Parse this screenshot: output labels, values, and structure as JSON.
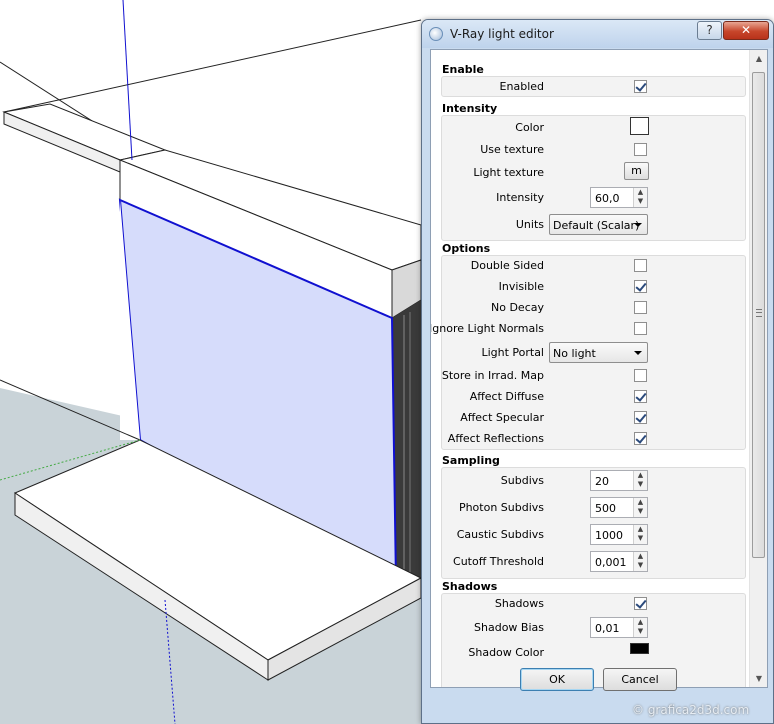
{
  "viewport": {
    "background_color": "#ffffff",
    "ground_color": "#c9d3d8",
    "light_fill": "#d6dcfb",
    "edge_blue": "#1010d0"
  },
  "dialog": {
    "title": "V-Ray light editor",
    "help_label": "?",
    "close_label": "✕",
    "ok_label": "OK",
    "cancel_label": "Cancel"
  },
  "sections": {
    "enable": {
      "title": "Enable",
      "enabled": {
        "label": "Enabled",
        "checked": true
      }
    },
    "intensity": {
      "title": "Intensity",
      "color": {
        "label": "Color",
        "value": "#ffffff"
      },
      "use_texture": {
        "label": "Use texture",
        "checked": false
      },
      "light_texture": {
        "label": "Light texture",
        "button": "m"
      },
      "intensity": {
        "label": "Intensity",
        "value": "60,0"
      },
      "units": {
        "label": "Units",
        "value": "Default (Scalar)"
      }
    },
    "options": {
      "title": "Options",
      "double_sided": {
        "label": "Double Sided",
        "checked": false
      },
      "invisible": {
        "label": "Invisible",
        "checked": true
      },
      "no_decay": {
        "label": "No Decay",
        "checked": false
      },
      "ignore_normals": {
        "label": "Ignore Light Normals",
        "checked": false
      },
      "light_portal": {
        "label": "Light Portal",
        "value": "No light"
      },
      "store_irrad": {
        "label": "Store in Irrad. Map",
        "checked": false
      },
      "affect_diffuse": {
        "label": "Affect Diffuse",
        "checked": true
      },
      "affect_specular": {
        "label": "Affect Specular",
        "checked": true
      },
      "affect_reflections": {
        "label": "Affect Reflections",
        "checked": true
      }
    },
    "sampling": {
      "title": "Sampling",
      "subdivs": {
        "label": "Subdivs",
        "value": "20"
      },
      "photon_subdivs": {
        "label": "Photon Subdivs",
        "value": "500"
      },
      "caustic_subdivs": {
        "label": "Caustic Subdivs",
        "value": "1000"
      },
      "cutoff": {
        "label": "Cutoff Threshold",
        "value": "0,001"
      }
    },
    "shadows": {
      "title": "Shadows",
      "shadows": {
        "label": "Shadows",
        "checked": true
      },
      "shadow_bias": {
        "label": "Shadow Bias",
        "value": "0,01"
      },
      "shadow_color": {
        "label": "Shadow Color",
        "value": "#000000"
      }
    }
  },
  "watermark": "© grafica2d3d.com"
}
